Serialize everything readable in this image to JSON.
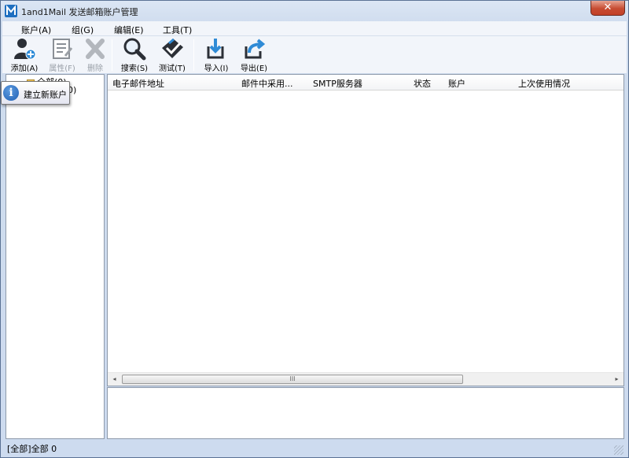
{
  "window": {
    "title": "1and1Mail 发送邮箱账户管理",
    "close_glyph": "✕",
    "app_icon": "M-logo-icon",
    "accent": "#1e6fc0"
  },
  "menu": [
    {
      "label": "账户(A)"
    },
    {
      "label": "组(G)"
    },
    {
      "label": "编辑(E)"
    },
    {
      "label": "工具(T)"
    }
  ],
  "toolbar": {
    "add": {
      "label": "添加(A)",
      "icon": "add-user-icon",
      "enabled": true
    },
    "properties": {
      "label": "属性(F)",
      "icon": "properties-icon",
      "enabled": false
    },
    "delete": {
      "label": "删除",
      "icon": "delete-icon",
      "enabled": false
    },
    "search": {
      "label": "搜索(S)",
      "icon": "search-icon",
      "enabled": true
    },
    "test": {
      "label": "测试(T)",
      "icon": "test-check-icon",
      "enabled": true
    },
    "import": {
      "label": "导入(I)",
      "icon": "import-icon",
      "enabled": true
    },
    "export": {
      "label": "导出(E)",
      "icon": "export-icon",
      "enabled": true
    }
  },
  "tree": {
    "root_label": "全部(0)",
    "root_label_hidden_part": "0)"
  },
  "list": {
    "columns": [
      "电子邮件地址",
      "邮件中采用...",
      "SMTP服务器",
      "状态",
      "账户",
      "上次使用情况"
    ],
    "rows": [],
    "scroll_arrow_left": "◂",
    "scroll_arrow_right": "▸",
    "scroll_grip": "III"
  },
  "tooltip": {
    "icon_glyph": "i",
    "text": "建立新账户"
  },
  "status": {
    "text": "[全部]全部 0"
  }
}
